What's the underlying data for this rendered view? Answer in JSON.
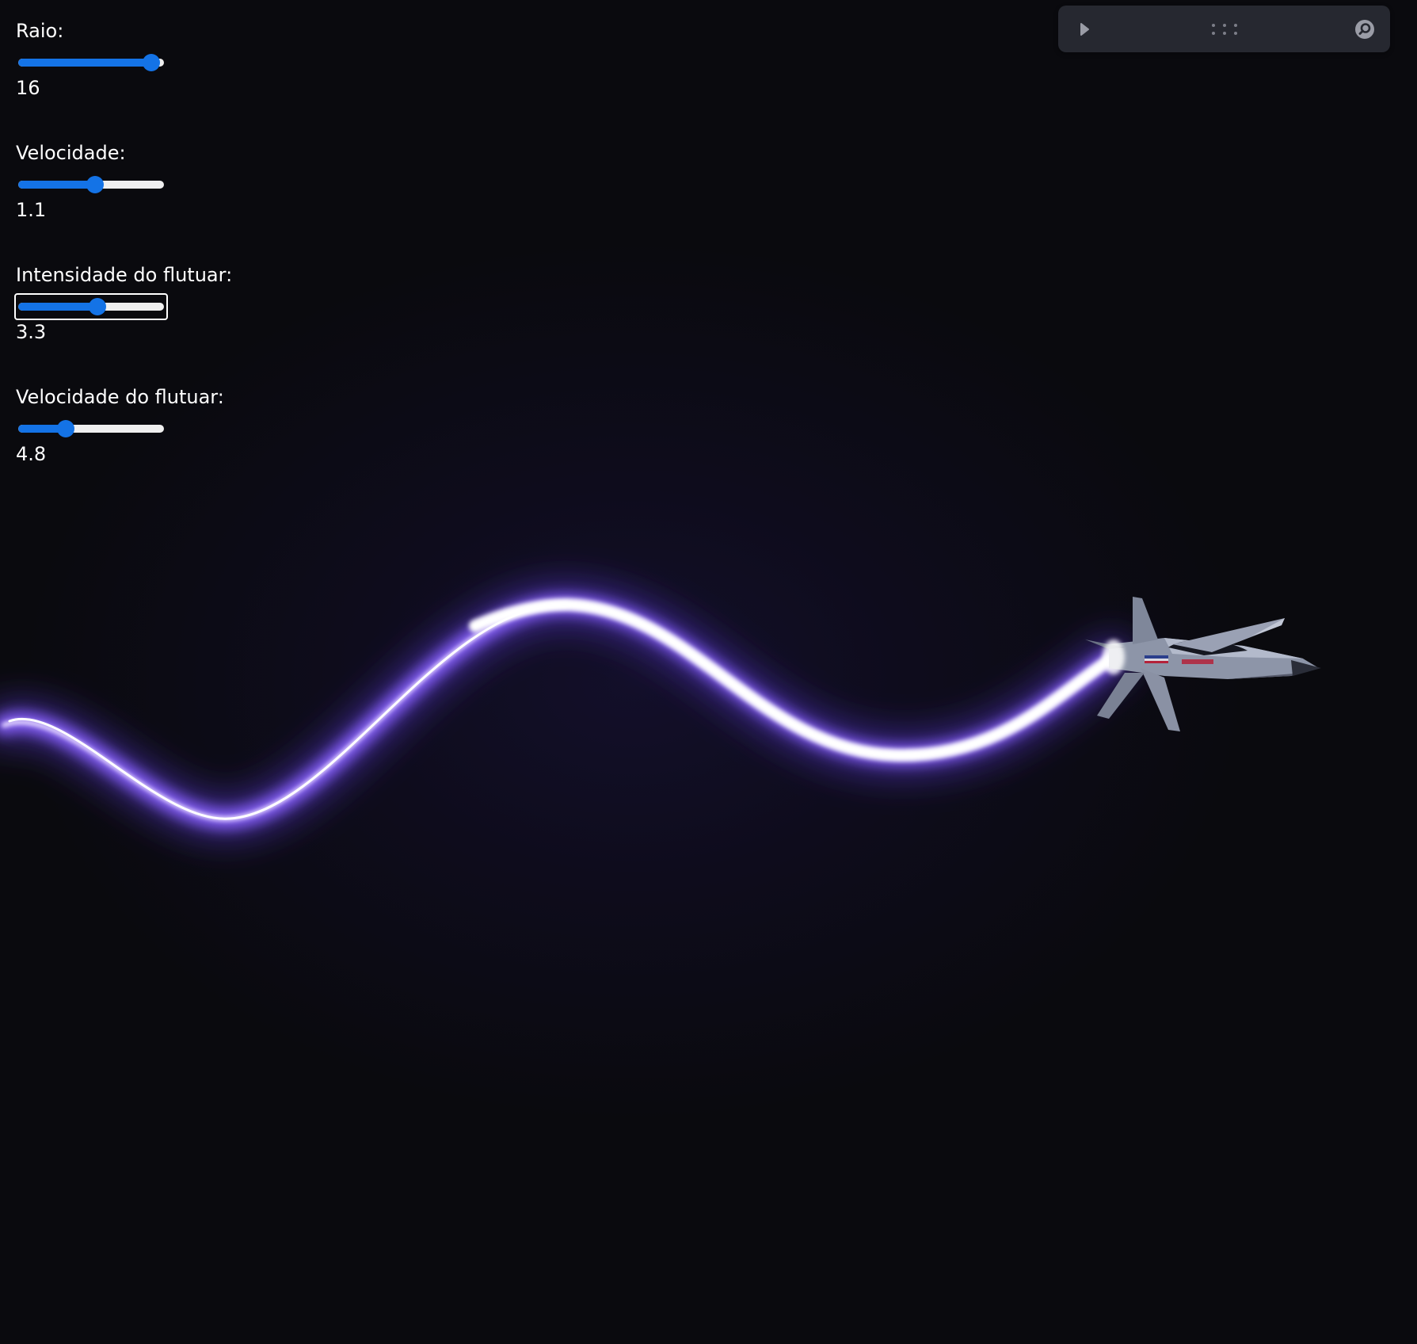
{
  "controls": [
    {
      "label": "Raio:",
      "value": "16",
      "level": 0.95
    },
    {
      "label": "Velocidade:",
      "value": "1.1",
      "level": 0.53
    },
    {
      "label": "Intensidade do flutuar:",
      "value": "3.3",
      "level": 0.55,
      "focused": true
    },
    {
      "label": "Velocidade do flutuar:",
      "value": "4.8",
      "level": 0.31
    }
  ],
  "toolbar": {
    "icons": [
      "play-icon",
      "drag-handle-icon",
      "search-icon"
    ]
  },
  "colors": {
    "background": "#0a0a0e",
    "slider_accent": "#1473e6",
    "slider_track": "#efefef",
    "trail_glow": "#7b55ff",
    "trail_core": "#ffffff",
    "toolbar_bg": "#262830",
    "toolbar_icon": "#9a9ca6"
  }
}
